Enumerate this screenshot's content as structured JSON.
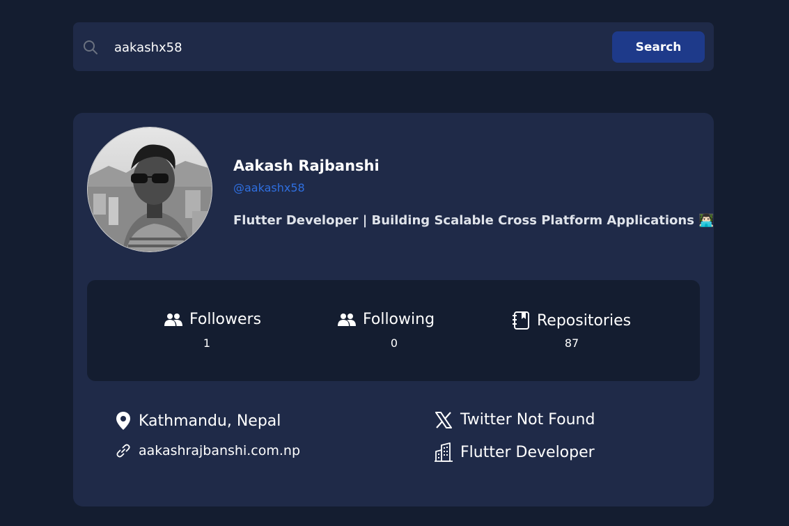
{
  "search": {
    "value": "aakashx58",
    "button_label": "Search"
  },
  "profile": {
    "name": "Aakash Rajbanshi",
    "login": "@aakashx58",
    "bio": "Flutter Developer | Building Scalable Cross Platform Applications 👨🏻‍💻",
    "avatar_icon": "user-photo-avatar"
  },
  "stats": {
    "followers_label": "Followers",
    "followers_value": "1",
    "following_label": "Following",
    "following_value": "0",
    "repositories_label": "Repositories",
    "repositories_value": "87"
  },
  "info": {
    "location": "Kathmandu, Nepal",
    "website": "aakashrajbanshi.com.np",
    "twitter": "Twitter Not Found",
    "company": "Flutter Developer"
  },
  "colors": {
    "background": "#141d30",
    "card": "#1f2a48",
    "button": "#1e3a8a",
    "link": "#2f6fe0"
  }
}
